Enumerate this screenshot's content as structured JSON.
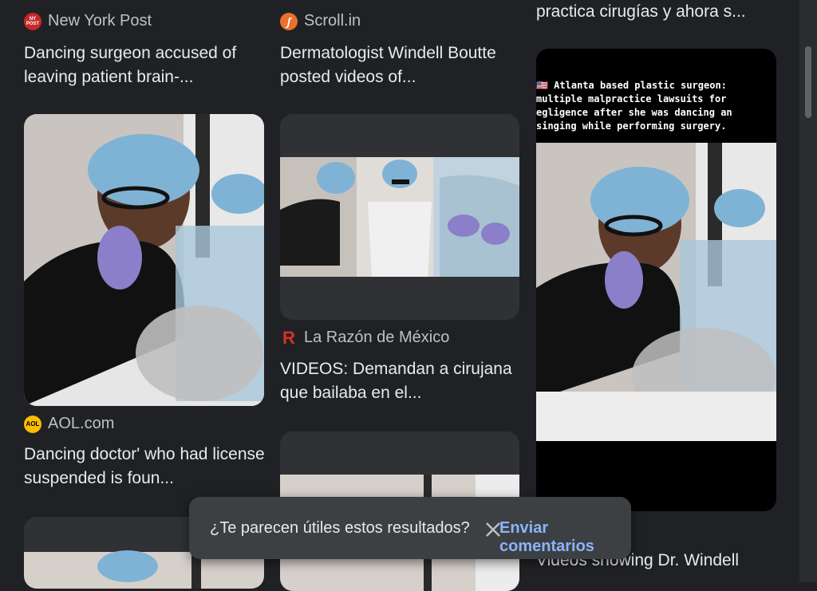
{
  "results": [
    {
      "source": "New York Post",
      "title": "Dancing surgeon accused of leaving patient brain-..."
    },
    {
      "source": "Scroll.in",
      "title": "Dermatologist Windell Boutte posted videos of..."
    },
    {
      "title_top": "practica cirugías y ahora s..."
    },
    {
      "source": "AOL.com",
      "title": "Dancing doctor' who had license suspended is foun..."
    },
    {
      "source": "La Razón de México",
      "title": "VIDEOS: Demandan a cirujana que bailaba en el..."
    },
    {
      "title_bottom": "Videos showing Dr. Windell"
    }
  ],
  "caption": {
    "lines": [
      "🇺🇸 Atlanta based plastic surgeon:",
      " multiple malpractice lawsuits for",
      "egligence after she was dancing an",
      " singing while performing surgery."
    ]
  },
  "toast": {
    "question": "¿Te parecen útiles estos resultados?",
    "link": "Enviar comentarios"
  },
  "favicons": {
    "nypost": "NY POST",
    "aol": "AOL"
  },
  "colors": {
    "background": "#202124",
    "link": "#8ab4f8",
    "scroll_orange": "#e8712e",
    "razon_red": "#d93025",
    "aol_yellow": "#fbbc04"
  }
}
